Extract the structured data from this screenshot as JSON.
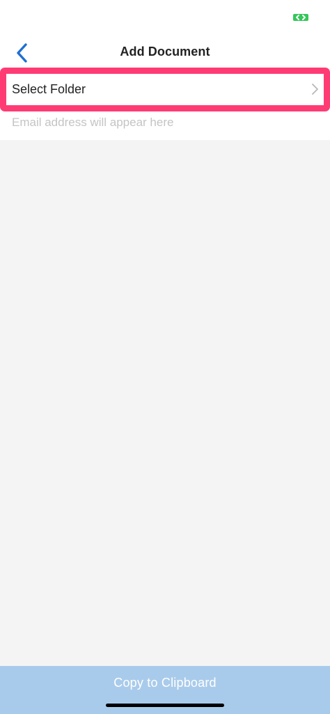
{
  "colors": {
    "accent_blue": "#1f6fd1",
    "highlight_pink": "#ff3b74",
    "status_green": "#34c759",
    "content_gray": "#f4f4f4",
    "button_disabled_blue": "#a9cbeb"
  },
  "nav": {
    "back_icon": "chevron-left-icon",
    "title": "Add Document"
  },
  "form": {
    "select_folder_label": "Select Folder",
    "select_folder_icon": "chevron-right-icon",
    "email_placeholder": "Email address will appear here"
  },
  "footer": {
    "copy_button_label": "Copy to Clipboard"
  }
}
